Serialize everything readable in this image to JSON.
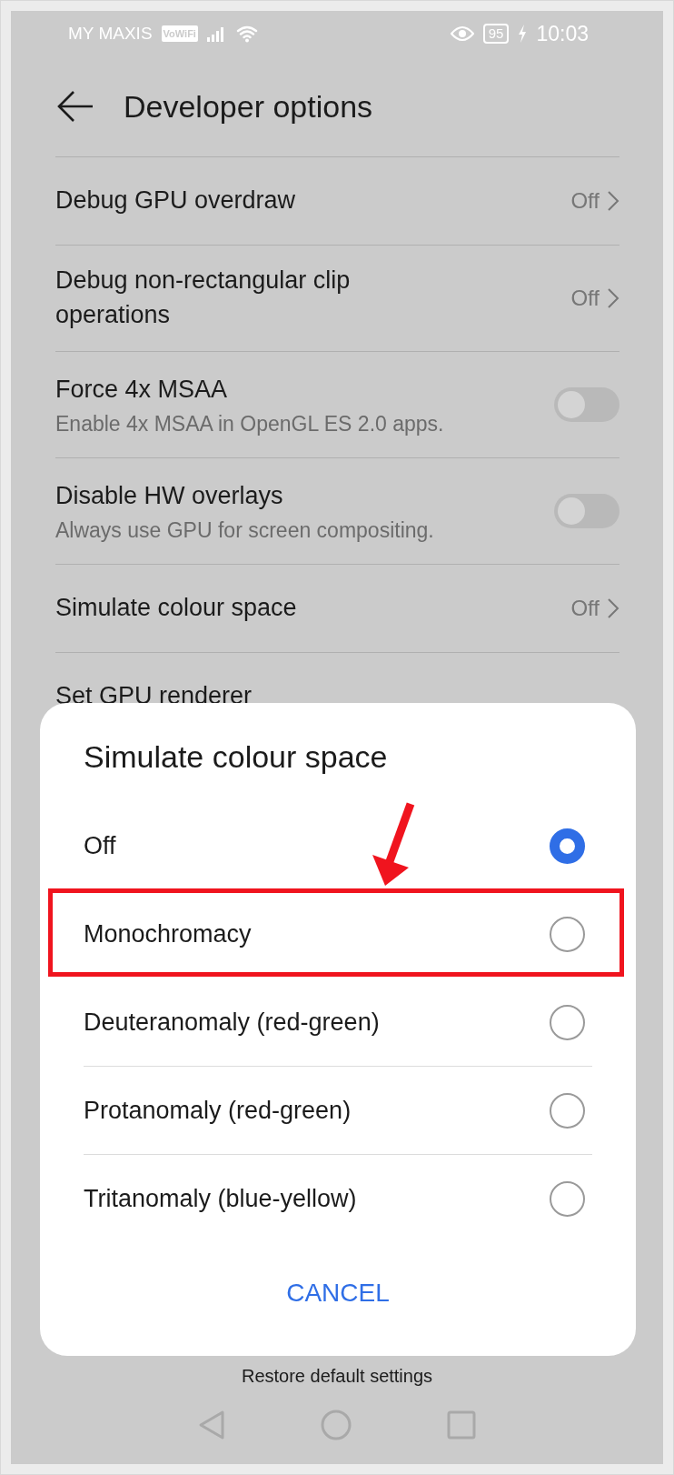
{
  "status_bar": {
    "carrier": "MY MAXIS",
    "badge": "VoWiFi",
    "battery": "95",
    "charging": true,
    "time": "10:03"
  },
  "header": {
    "title": "Developer options"
  },
  "rows": [
    {
      "kind": "value",
      "title": "Debug GPU overdraw",
      "value": "Off"
    },
    {
      "kind": "value",
      "title": "Debug non-rectangular clip operations",
      "value": "Off"
    },
    {
      "kind": "toggle",
      "title": "Force 4x MSAA",
      "subtitle": "Enable 4x MSAA in OpenGL ES 2.0 apps.",
      "on": false
    },
    {
      "kind": "toggle",
      "title": "Disable HW overlays",
      "subtitle": "Always use GPU for screen compositing.",
      "on": false
    },
    {
      "kind": "value",
      "title": "Simulate colour space",
      "value": "Off"
    },
    {
      "kind": "plain",
      "title": "Set GPU renderer"
    }
  ],
  "footer_link": "Restore default settings",
  "dialog": {
    "title": "Simulate colour space",
    "options": [
      {
        "label": "Off",
        "selected": true,
        "highlighted": false
      },
      {
        "label": "Monochromacy",
        "selected": false,
        "highlighted": true
      },
      {
        "label": "Deuteranomaly (red-green)",
        "selected": false,
        "highlighted": false
      },
      {
        "label": "Protanomaly (red-green)",
        "selected": false,
        "highlighted": false
      },
      {
        "label": "Tritanomaly (blue-yellow)",
        "selected": false,
        "highlighted": false
      }
    ],
    "button": "CANCEL"
  }
}
